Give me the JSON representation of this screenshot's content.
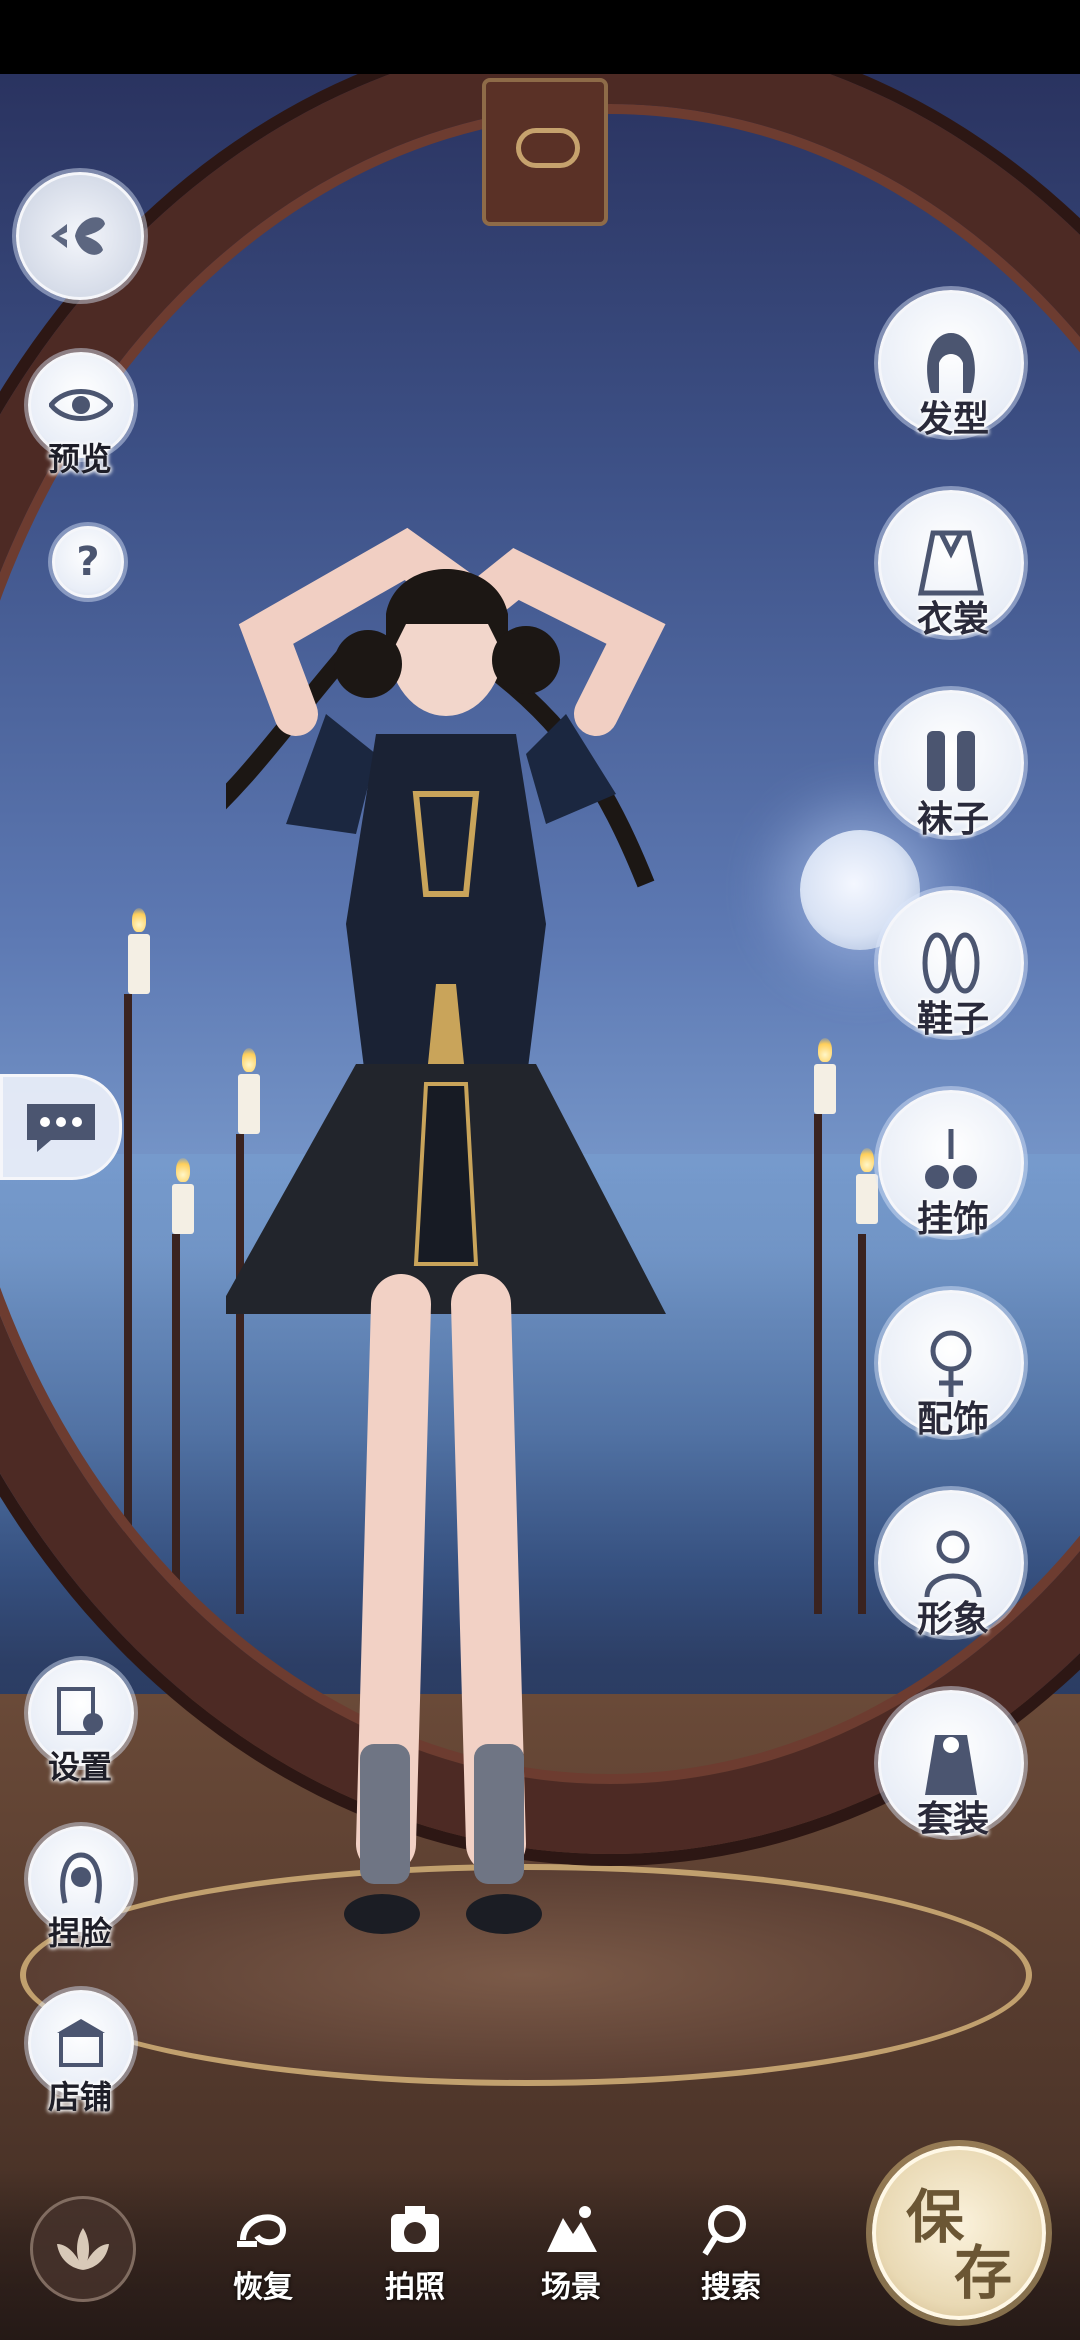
{
  "right_menu": [
    {
      "label": "发型",
      "icon": "hairstyle-icon"
    },
    {
      "label": "衣裳",
      "icon": "clothing-icon"
    },
    {
      "label": "袜子",
      "icon": "socks-icon"
    },
    {
      "label": "鞋子",
      "icon": "shoes-icon"
    },
    {
      "label": "挂饰",
      "icon": "pendant-icon"
    },
    {
      "label": "配饰",
      "icon": "accessory-icon"
    },
    {
      "label": "形象",
      "icon": "appearance-icon"
    },
    {
      "label": "套装",
      "icon": "outfit-set-icon"
    }
  ],
  "left_top": {
    "preview_label": "预览",
    "help_symbol": "?"
  },
  "left_bottom": [
    {
      "label": "设置",
      "icon": "settings-icon"
    },
    {
      "label": "捏脸",
      "icon": "face-edit-icon"
    },
    {
      "label": "店铺",
      "icon": "shop-icon"
    }
  ],
  "bottom_bar": [
    {
      "label": "恢复",
      "icon": "restore-icon"
    },
    {
      "label": "拍照",
      "icon": "camera-icon"
    },
    {
      "label": "场景",
      "icon": "scene-icon"
    },
    {
      "label": "搜索",
      "icon": "search-icon"
    }
  ],
  "save": {
    "char1": "保",
    "char2": "存"
  },
  "colors": {
    "frame": "#4d2a24",
    "label": "#2a2a3a",
    "button_bg": "#e9eef7",
    "save_text": "#6b5634"
  }
}
